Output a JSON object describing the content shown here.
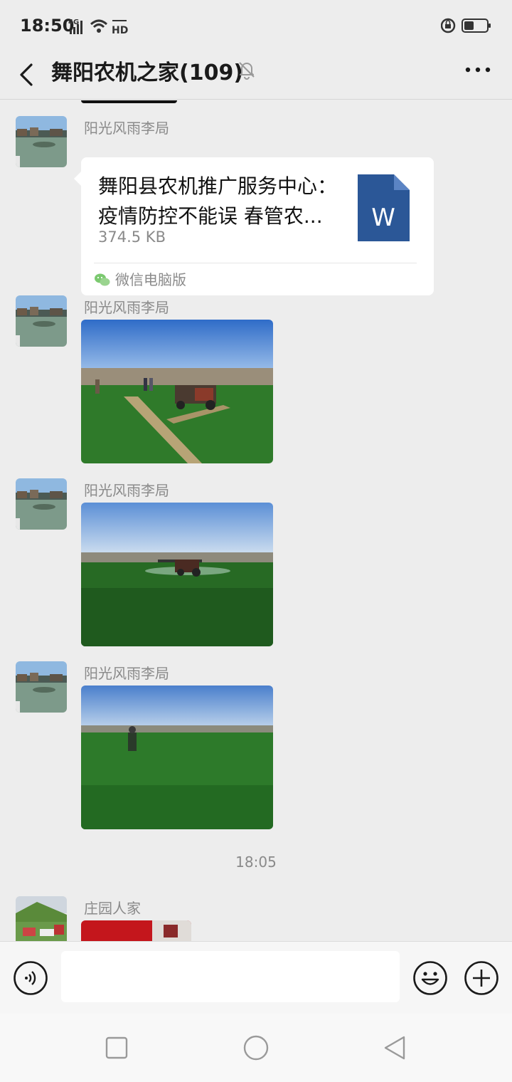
{
  "status_bar": {
    "time": "18:50",
    "network": "4G",
    "hd": "HD"
  },
  "header": {
    "title": "舞阳农机之家(109)",
    "back_icon": "chevron-left-icon",
    "mute_icon": "bell-off-icon",
    "more_icon": "more-dots-icon"
  },
  "messages": [
    {
      "sender": "阳光风雨李局",
      "type": "file",
      "file_name": "舞阳县农机推广服务中心：疫情防控不能误 春管农...",
      "file_size": "374.5 KB",
      "file_type_letter": "W",
      "source": "微信电脑版"
    },
    {
      "sender": "阳光风雨李局",
      "type": "image",
      "description_icon": "photo-field-tractor"
    },
    {
      "sender": "阳光风雨李局",
      "type": "image",
      "description_icon": "photo-field-sprayer"
    },
    {
      "sender": "阳光风雨李局",
      "type": "image",
      "description_icon": "photo-field-worker"
    }
  ],
  "timestamp": "18:05",
  "last_message": {
    "sender": "庄园人家"
  },
  "input": {
    "value": "",
    "voice_icon": "voice-icon",
    "emoji_icon": "emoji-icon",
    "plus_icon": "plus-icon"
  },
  "colors": {
    "background": "#ededed",
    "word_blue": "#2b5797",
    "bubble": "#ffffff"
  }
}
